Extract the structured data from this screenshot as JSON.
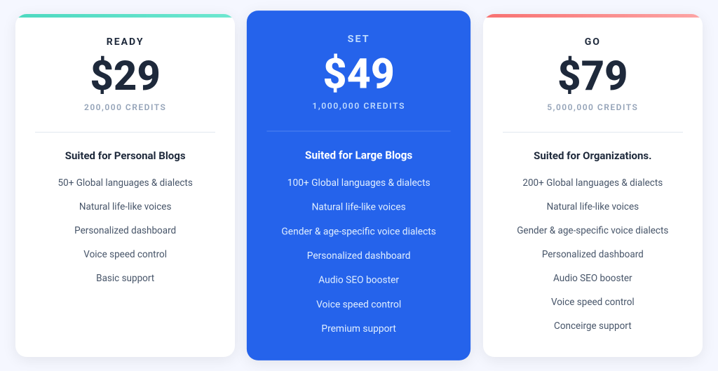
{
  "plans": [
    {
      "id": "ready",
      "name": "READY",
      "price": "$29",
      "credits": "200,000 CREDITS",
      "tagline": "Suited for Personal Blogs",
      "features": [
        "50+ Global languages & dialects",
        "Natural life-like voices",
        "Personalized dashboard",
        "Voice speed control",
        "Basic support"
      ],
      "featured": false,
      "cardClass": "ready"
    },
    {
      "id": "set",
      "name": "SET",
      "price": "$49",
      "credits": "1,000,000 CREDITS",
      "tagline": "Suited for Large Blogs",
      "features": [
        "100+ Global languages & dialects",
        "Natural life-like voices",
        "Gender & age-specific voice dialects",
        "Personalized dashboard",
        "Audio SEO booster",
        "Voice speed control",
        "Premium support"
      ],
      "featured": true,
      "cardClass": "featured"
    },
    {
      "id": "go",
      "name": "GO",
      "price": "$79",
      "credits": "5,000,000 CREDITS",
      "tagline": "Suited for Organizations.",
      "features": [
        "200+ Global languages & dialects",
        "Natural life-like voices",
        "Gender & age-specific voice dialects",
        "Personalized dashboard",
        "Audio SEO booster",
        "Voice speed control",
        "Conceirge support"
      ],
      "featured": false,
      "cardClass": "go"
    }
  ]
}
